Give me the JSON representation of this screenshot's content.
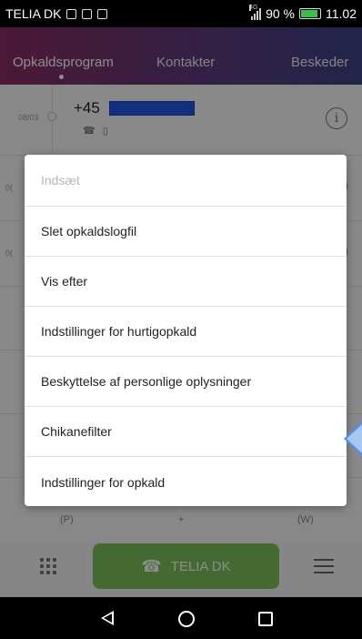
{
  "status_bar": {
    "carrier": "TELIA DK",
    "network_badge": "4G",
    "battery_percent": "90 %",
    "time": "11.02"
  },
  "tabs": [
    {
      "label": "Opkaldsprogram",
      "active": true
    },
    {
      "label": "Kontakter",
      "active": false
    },
    {
      "label": "Beskeder",
      "active": false
    }
  ],
  "call_log": [
    {
      "date": "08/03",
      "number": "+45"
    },
    {
      "date": "0(",
      "number": ""
    },
    {
      "date": "0(",
      "number": ""
    }
  ],
  "dialpad_hints": [
    "(P)",
    "+",
    "(W)"
  ],
  "bottom_bar": {
    "call_button_label": "TELIA DK"
  },
  "context_menu": {
    "items": [
      {
        "label": "Indsæt",
        "enabled": false
      },
      {
        "label": "Slet opkaldslogfil",
        "enabled": true
      },
      {
        "label": "Vis efter",
        "enabled": true
      },
      {
        "label": "Indstillinger for hurtigopkald",
        "enabled": true
      },
      {
        "label": "Beskyttelse af personlige oplysninger",
        "enabled": true
      },
      {
        "label": "Chikanefilter",
        "enabled": true
      },
      {
        "label": "Indstillinger for opkald",
        "enabled": true
      }
    ]
  },
  "colors": {
    "tabbar_start": "#8a2e63",
    "tabbar_end": "#3e4386",
    "call_button": "#7ec25a",
    "redaction": "#2356e6",
    "pointer": "#5a8fdc"
  }
}
